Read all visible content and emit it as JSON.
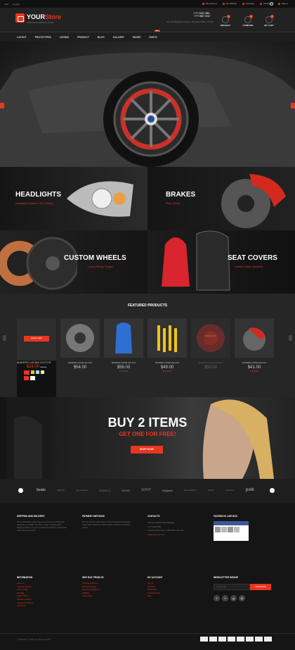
{
  "topbar": {
    "currency": "USD",
    "language": "English",
    "links": [
      "My Account",
      "My Wishlist",
      "Compare",
      "Checkout",
      "Sign in"
    ]
  },
  "header": {
    "logo_prefix": "YOUR",
    "logo_suffix": "Store",
    "tagline": "PREMIUM ECOMMERCE STORE",
    "phone1": "+777 2345 7885;",
    "phone2": "+777 6867 5152",
    "address": "New York Broadway, 8 Avenue, 345 Suite 34 Sirius, 3rd floor",
    "wishlist_label": "WISHLIST",
    "wishlist_count": "0",
    "compare_label": "COMPARE",
    "compare_count": "0",
    "cart_label": "MY CART",
    "cart_count": "0"
  },
  "nav": {
    "items": [
      "LAYOUT",
      "PROTOTYPES",
      "LISTING",
      "PRODUCT",
      "BLOG",
      "GALLERY",
      "PAGES",
      "PARTS"
    ],
    "sale_badge": "SALE"
  },
  "categories": [
    {
      "title": "HEADLIGHTS",
      "sub": "Headlights Projector, LED, Factory"
    },
    {
      "title": "BRAKES",
      "sub": "Pads, Rotors"
    },
    {
      "title": "CUSTOM WHEELS",
      "sub": "Luxury Racing, Forged"
    },
    {
      "title": "SEAT COVERS",
      "sub": "Leather, Velour, Neoprene"
    }
  ],
  "featured": {
    "title": "FEATURED PRODUCTS",
    "products": [
      {
        "name": "MAKERS LACMA LECTUS",
        "price": "$26.00",
        "old": "$36.00",
        "quick": "QUICK VIEW"
      },
      {
        "name": "MAKERS LACMA LECTUS",
        "price": "$54.00"
      },
      {
        "name": "MAKERS LACMA LECTUS",
        "price": "$56.00"
      },
      {
        "name": "MAKERS LACMA LECTUS",
        "price": "$49.00"
      },
      {
        "name": "MAKERS LACMA LECTUS",
        "price": "$50.00",
        "badge": "SOLD OUT"
      },
      {
        "name": "MAKERS LACMA LECTUS",
        "price": "$41.00"
      }
    ]
  },
  "promo": {
    "title": "BUY 2 ITEMS",
    "subtitle": "GET ONE FOR FREE!",
    "button": "SHOP NOW!"
  },
  "brands": [
    "beats",
    "DENON",
    "harman/kardon",
    "SPARCO",
    "BOSE",
    "SONY",
    "Klipsch",
    "Bowers&Wilkins",
    "SONUS",
    "Sennheiser",
    "polk"
  ],
  "footer": {
    "col1_title": "SHIPPING AND DELIVERY",
    "col1_text": "We're dedicated to delivering your purchase as quickly and efficiently as possible. We offer a range of delivery and shipping options, so you can choose the shipping method that best meets your needs.",
    "col2_title": "PAYMENT METHODS",
    "col2_text": "For our country's wide range of payment options we support credit cards, PayPal and bank transfer. Payment is fast and secure.",
    "col3_title": "CONTACTS",
    "contacts": [
      "7245 NL Linkside Plaza Delaware",
      "+777 2345 7885",
      "1 Regent Street Post: 10786 North Ohio Usa",
      "info@mydomain.com"
    ],
    "col4_title": "FACEBOOK LIKE BOX",
    "info_title": "INFORMATION",
    "info_links": [
      "About Us",
      "Customer Service",
      "Privacy Policy",
      "Site Map",
      "Search Terms",
      "Advanced Search",
      "Orders and Returns",
      "Contact Us"
    ],
    "why_title": "WHY BUY FROM US",
    "why_links": [
      "Shipping & Returns",
      "Secure Shopping",
      "International Shipping",
      "Affiliates",
      "Group Sales"
    ],
    "account_title": "MY ACCOUNT",
    "account_links": [
      "Sign In",
      "View Cart",
      "My Wishlist",
      "Track My Order",
      "Help"
    ],
    "newsletter_title": "NEWSLETTER SIGNUP",
    "newsletter_placeholder": "Your E-mail",
    "subscribe": "SUBSCRIBE",
    "copyright": "YOURStore © 2016. All rights reserved."
  },
  "colors": {
    "accent": "#e8361f"
  }
}
